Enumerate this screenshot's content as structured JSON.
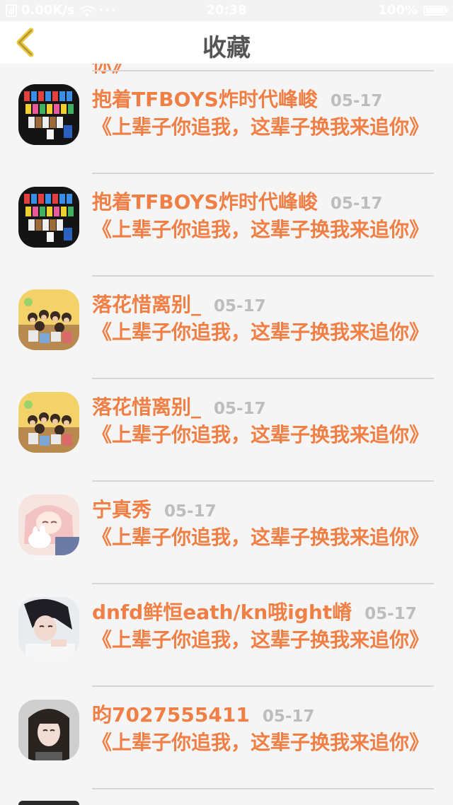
{
  "status_bar": {
    "network_speed": "0.00K/s",
    "time": "20:38",
    "battery": "100%",
    "battery_level": 1.0
  },
  "nav": {
    "title": "收藏",
    "back_icon": "chevron-left-icon",
    "accent_color": "#e8c53a"
  },
  "colors": {
    "name": "#f07f45",
    "content": "#f07f45",
    "date": "#bdbdbd",
    "divider": "#d6d6d6"
  },
  "top_clipped_text": "你》",
  "items": [
    {
      "name": "抱着TFBOYS炸时代峰峻",
      "date": "05-17",
      "content": "《上辈子你追我，这辈子换我来追你》",
      "avatar": "group-photo-dark"
    },
    {
      "name": "抱着TFBOYS炸时代峰峻",
      "date": "05-17",
      "content": "《上辈子你追我，这辈子换我来追你》",
      "avatar": "group-photo-dark"
    },
    {
      "name": "落花惜离别_",
      "date": "05-17",
      "content": "《上辈子你追我，这辈子换我来追你》",
      "avatar": "group-photo-yellow"
    },
    {
      "name": "落花惜离别_",
      "date": "05-17",
      "content": "《上辈子你追我，这辈子换我来追你》",
      "avatar": "group-photo-yellow"
    },
    {
      "name": "宁真秀",
      "date": "05-17",
      "content": "《上辈子你追我，这辈子换我来追你》",
      "avatar": "anime-girl-pink"
    },
    {
      "name": "dnfd鲜恒eath/kn哦ight嵴",
      "date": "05-17",
      "content": "《上辈子你追我，这辈子换我来追你》",
      "avatar": "girl-portrait"
    },
    {
      "name": "昀7027555411",
      "date": "05-17",
      "content": "《上辈子你追我，这辈子换我来追你》",
      "avatar": "girl-selfie"
    }
  ]
}
